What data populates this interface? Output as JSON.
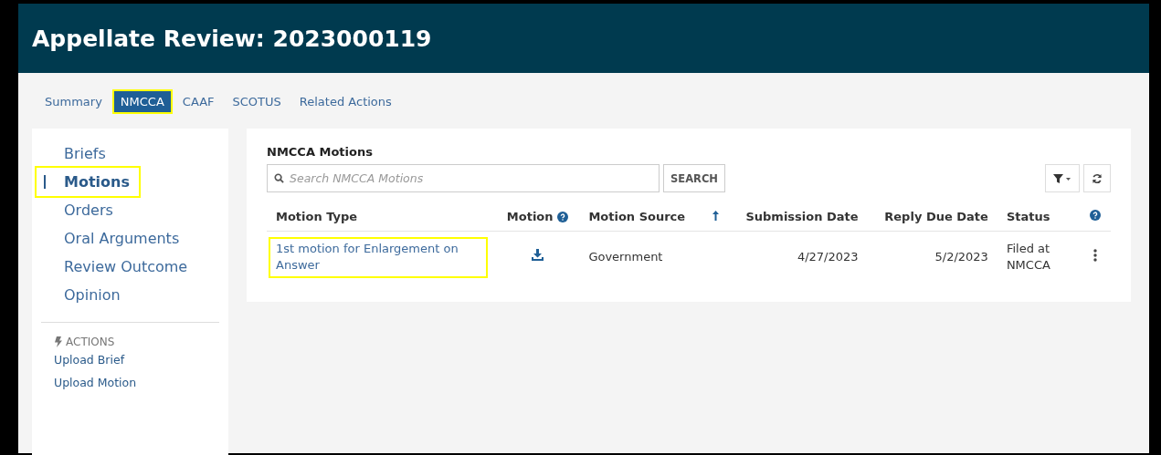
{
  "title": "Appellate Review: 2023000119",
  "tabs": [
    {
      "label": "Summary",
      "selected": false,
      "highlighted": false
    },
    {
      "label": "NMCCA",
      "selected": true,
      "highlighted": true
    },
    {
      "label": "CAAF",
      "selected": false,
      "highlighted": false
    },
    {
      "label": "SCOTUS",
      "selected": false,
      "highlighted": false
    },
    {
      "label": "Related Actions",
      "selected": false,
      "highlighted": false
    }
  ],
  "sidebar": {
    "items": [
      {
        "label": "Briefs",
        "selected": false,
        "highlighted": false
      },
      {
        "label": "Motions",
        "selected": true,
        "highlighted": true
      },
      {
        "label": "Orders",
        "selected": false,
        "highlighted": false
      },
      {
        "label": "Oral Arguments",
        "selected": false,
        "highlighted": false
      },
      {
        "label": "Review Outcome",
        "selected": false,
        "highlighted": false
      },
      {
        "label": "Opinion",
        "selected": false,
        "highlighted": false
      }
    ],
    "actions_heading": "ACTIONS",
    "actions": [
      "Upload Brief",
      "Upload Motion"
    ]
  },
  "panel": {
    "title": "NMCCA Motions",
    "search": {
      "placeholder": "Search NMCCA Motions"
    },
    "search_button": "SEARCH",
    "table": {
      "columns": [
        {
          "kind": "text",
          "label": "Motion Type"
        },
        {
          "kind": "help",
          "label": "Motion"
        },
        {
          "kind": "text",
          "label": "Motion Source"
        },
        {
          "kind": "sort"
        },
        {
          "kind": "numeric",
          "label": "Submission Date"
        },
        {
          "kind": "numeric",
          "label": "Reply Due Date"
        },
        {
          "kind": "text",
          "label": "Status"
        },
        {
          "kind": "help"
        }
      ],
      "rows": [
        {
          "motion_type": "1st motion for Enlargement on Answer",
          "highlighted": true,
          "source": "Government",
          "submission_date": "4/27/2023",
          "reply_due_date": "5/2/2023",
          "status": "Filed at NMCCA"
        }
      ]
    }
  }
}
